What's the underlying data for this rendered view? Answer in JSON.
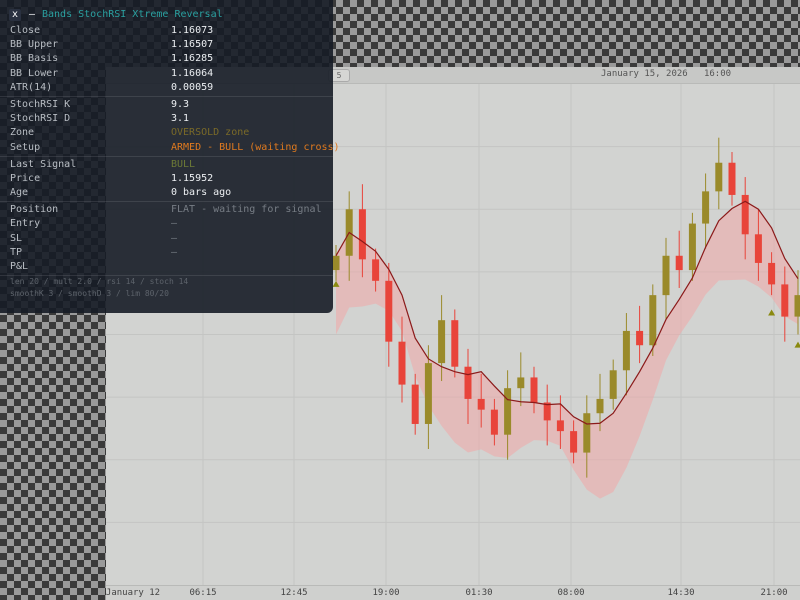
{
  "panel": {
    "close_label": "x",
    "minimize_label": "–",
    "title": "Bands StochRSI Xtreme Reversal",
    "price_rows": [
      {
        "label": "Close",
        "value": "1.16073"
      },
      {
        "label": "BB Upper",
        "value": "1.16507"
      },
      {
        "label": "BB Basis",
        "value": "1.16285"
      },
      {
        "label": "BB Lower",
        "value": "1.16064"
      },
      {
        "label": "ATR(14)",
        "value": "0.00059"
      }
    ],
    "stoch_rows": [
      {
        "label": "StochRSI K",
        "value": "9.3"
      },
      {
        "label": "StochRSI D",
        "value": "3.1"
      },
      {
        "label": "Zone",
        "value": "OVERSOLD zone"
      },
      {
        "label": "Setup",
        "value": "ARMED - BULL (waiting cross)"
      }
    ],
    "signal_rows": [
      {
        "label": "Last Signal",
        "value": "BULL"
      },
      {
        "label": "Price",
        "value": "1.15952"
      },
      {
        "label": "Age",
        "value": "0 bars ago"
      }
    ],
    "position_rows": [
      {
        "label": "Position",
        "value": "FLAT - waiting for signal"
      },
      {
        "label": "Entry",
        "value": "–"
      },
      {
        "label": "SL",
        "value": "–"
      },
      {
        "label": "TP",
        "value": "–"
      },
      {
        "label": "P&L",
        "value": ""
      }
    ],
    "footer": [
      "len 20 / mult 2.0 / rsi 14 / stoch 14",
      "smoothK 3 / smoothD 3 / lim 80/20"
    ]
  },
  "chart": {
    "header_chip": "5",
    "header_date": "January 15, 2026   16:00",
    "time_labels": [
      "January 12",
      "06:15",
      "12:45",
      "19:00",
      "01:30",
      "08:00",
      "14:30",
      "21:00"
    ],
    "colors": {
      "bull": "#9a8a2a",
      "bear": "#e8443a",
      "basis": "#8b1a1a",
      "band_upper": "#a9c4cc",
      "band_lower": "#f0a8a8",
      "signal_marker": "#8a8a10",
      "grid": "#c4c5c3"
    }
  },
  "chart_data": {
    "type": "candlestick",
    "x": [
      "January 12",
      "06:15",
      "12:45",
      "19:00",
      "01:30",
      "08:00",
      "14:30",
      "21:00"
    ],
    "series": [
      {
        "name": "",
        "values": [
          1.1612,
          1.1625,
          1.1611,
          1.1605,
          1.1588,
          1.1576,
          1.1565,
          1.1582,
          1.1594,
          1.1581,
          1.1572,
          1.1569,
          1.1562,
          1.1575,
          1.1578,
          1.1571,
          1.1566,
          1.1563,
          1.1557,
          1.1568,
          1.1572,
          1.158,
          1.1591,
          1.1587,
          1.1601,
          1.1612,
          1.1608,
          1.1621,
          1.163,
          1.1638,
          1.1629,
          1.1618,
          1.161,
          1.1604,
          1.1595,
          1.1601
        ]
      }
    ],
    "title": "",
    "xlabel": "",
    "ylabel": "",
    "ylim": [
      1.152,
      1.166
    ],
    "grid": true
  }
}
